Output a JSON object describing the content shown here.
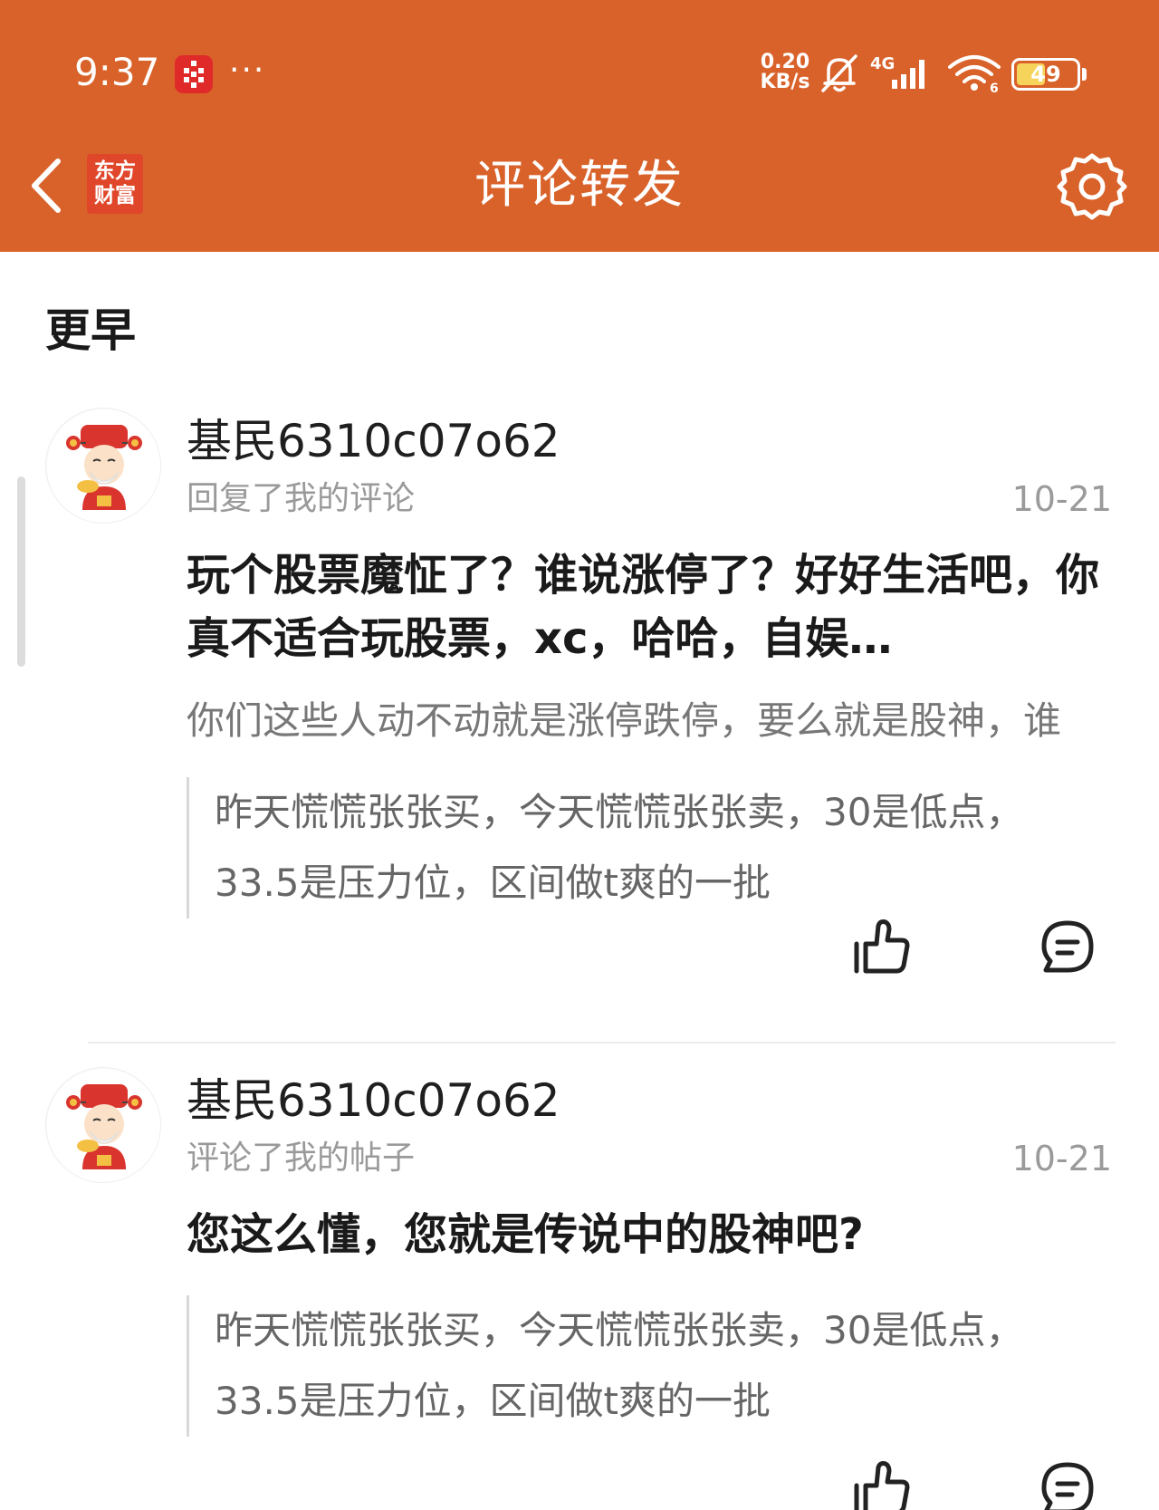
{
  "status_bar": {
    "time": "9:37",
    "more": "···",
    "net_speed_value": "0.20",
    "net_speed_unit": "KB/s",
    "network": "4G",
    "wifi_label": "6",
    "battery_level": "49",
    "battery_percent": 49
  },
  "header": {
    "brand_logo_text": "东方财富",
    "title": "评论转发",
    "accent_color": "#d9622a"
  },
  "section": {
    "title": "更早"
  },
  "notifications": [
    {
      "user_name": "基民6310c07o62",
      "action": "回复了我的评论",
      "date": "10-21",
      "comment": "玩个股票魔怔了？谁说涨停了？好好生活吧，你真不适合玩股票，xc，哈哈，自娱…",
      "quoted_reply": "你们这些人动不动就是涨停跌停，要么就是股神，谁",
      "original_post_line1": "昨天慌慌张张买，今天慌慌张张卖，30是低点，",
      "original_post_line2": "33.5是压力位，区间做t爽的一批"
    },
    {
      "user_name": "基民6310c07o62",
      "action": "评论了我的帖子",
      "date": "10-21",
      "comment": "您这么懂，您就是传说中的股神吧?",
      "original_post_line1": "昨天慌慌张张买，今天慌慌张张卖，30是低点，",
      "original_post_line2": "33.5是压力位，区间做t爽的一批"
    }
  ]
}
